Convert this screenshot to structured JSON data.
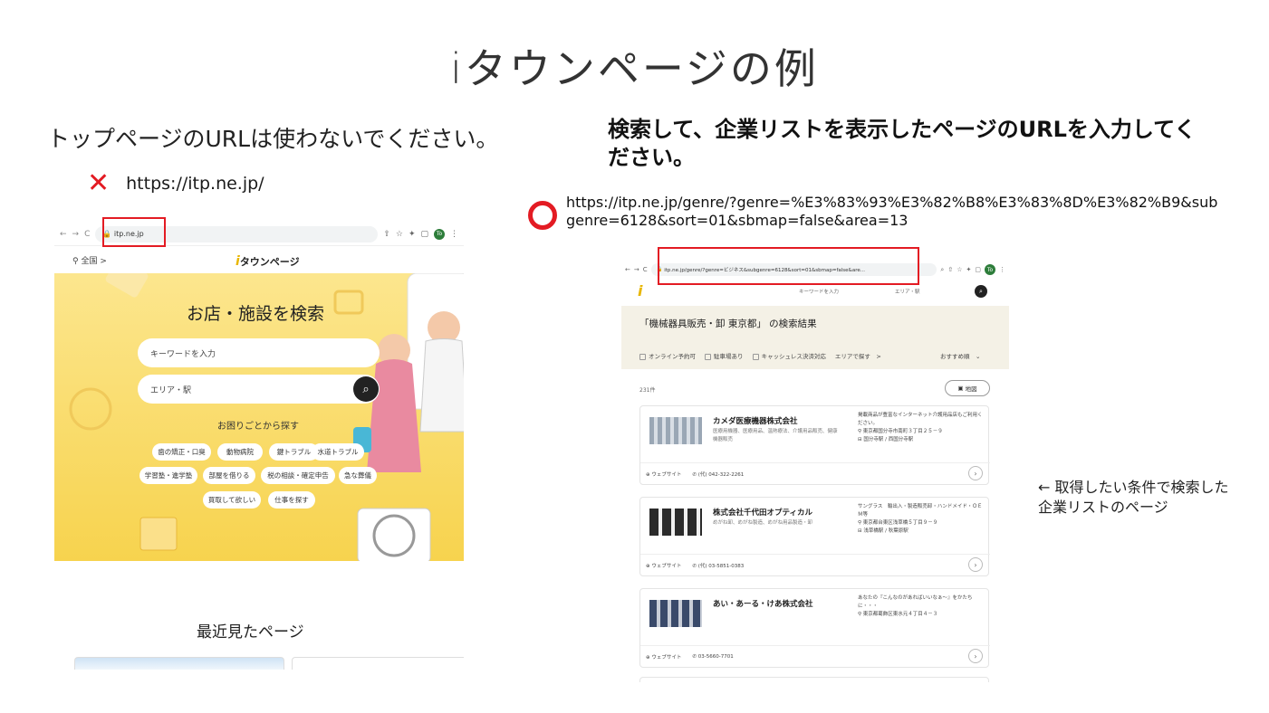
{
  "title": "iタウンページの例",
  "left": {
    "instruction": "トップページのURLは使わないでください。",
    "bad_url": "https://itp.ne.jp/",
    "screenshot": {
      "url": "itp.ne.jp",
      "location": "全国 >",
      "logo_text": "タウンページ",
      "hero_title": "お店・施設を検索",
      "keyword_placeholder": "キーワードを入力",
      "area_placeholder": "エリア・駅",
      "sub_heading": "お困りごとから探す",
      "chips": [
        "歯の矯正・口臭",
        "動物病院",
        "鍵トラブル",
        "水道トラブル",
        "学習塾・進学塾",
        "部屋を借りる",
        "税の相談・確定申告",
        "急な葬儀",
        "買取して欲しい",
        "仕事を探す"
      ],
      "recent_heading": "最近見たページ"
    }
  },
  "right": {
    "instruction": "検索して、企業リストを表示したページのURLを入力してください。",
    "good_url": "https://itp.ne.jp/genre/?genre=%E3%83%93%E3%82%B8%E3%83%8D%E3%82%B9&subgenre=6128&sort=01&sbmap=false&area=13",
    "screenshot": {
      "url": "itp.ne.jp/genre/?genre=ビジネス&subgenre=6128&sort=01&sbmap=false&are...",
      "keyword_placeholder": "キーワードを入力",
      "area_placeholder": "エリア・駅",
      "heading": "「機械器具販売・卸 東京都」 の検索結果",
      "filters": [
        "オンライン予約可",
        "駐車場あり",
        "キャッシュレス決済対応"
      ],
      "area_filter": "エリアで探す　>",
      "sort": "おすすめ順　⌄",
      "count": "231件",
      "map_button": "地図",
      "results": [
        {
          "name": "カメダ医療機器株式会社",
          "category": "医療用機器、医療用品、温熱療法、介護用品販売、健康機器販売",
          "desc": "掲載商品が豊富なインターネット介護用品店もご利用ください。",
          "address": "東京都国分寺市南町３丁目２５－９",
          "station": "国分寺駅 / 西国分寺駅",
          "website": "ウェブサイト",
          "phone": "(代) 042-322-2261"
        },
        {
          "name": "株式会社千代田オプティカル",
          "category": "めがね卸、めがね製造、めがね用品製造・卸",
          "desc": "サングラス　輸出入・製造販売卸・ハンドメイド・ＯＥＭ等",
          "address": "東京都台東区浅草橋５丁目９－９",
          "station": "浅草橋駅 / 秋葉原駅",
          "website": "ウェブサイト",
          "phone": "(代) 03-5851-0383"
        },
        {
          "name": "あい・あーる・けあ株式会社",
          "category": "",
          "desc": "あなたの『こんなのがあればいいなぁ～』をかたちに・・・",
          "address": "東京都葛飾区東水元４丁目４－３",
          "station": "",
          "website": "ウェブサイト",
          "phone": "03-5660-7701"
        }
      ]
    }
  },
  "side_note": "← 取得したい条件で検索した企業リストのページ",
  "colors": {
    "accent_red": "#e31b23",
    "hero_yellow": "#f7d34e"
  }
}
